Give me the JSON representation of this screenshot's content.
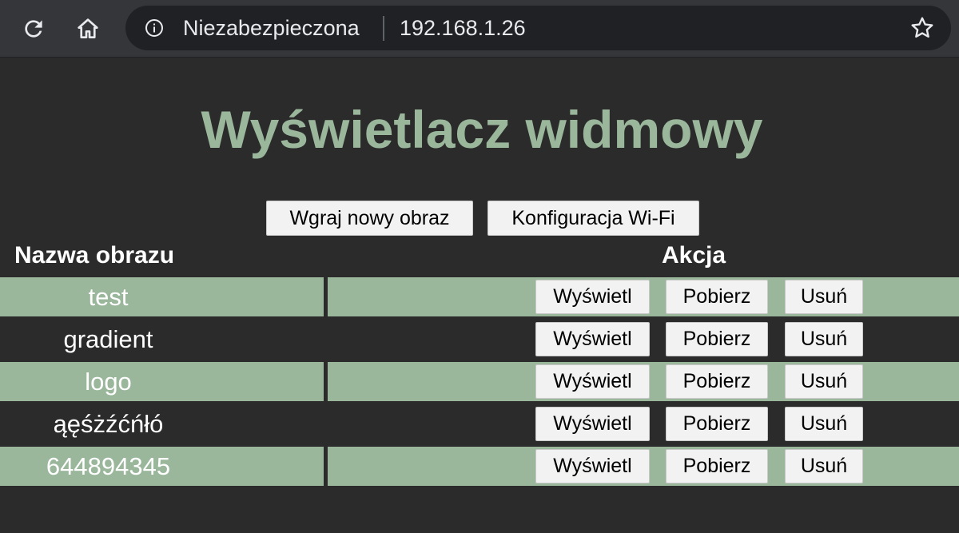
{
  "browser": {
    "security_label": "Niezabezpieczona",
    "url": "192.168.1.26",
    "icons": {
      "reload": "reload-icon",
      "home": "home-icon",
      "info": "info-icon",
      "bookmark": "star-icon"
    }
  },
  "page": {
    "title": "Wyświetlacz widmowy",
    "upload_button": "Wgraj nowy obraz",
    "wifi_button": "Konfiguracja Wi-Fi"
  },
  "table": {
    "headers": {
      "name": "Nazwa obrazu",
      "action": "Akcja"
    },
    "rows": [
      {
        "name": "test",
        "show": "Wyświetl",
        "download": "Pobierz",
        "delete": "Usuń"
      },
      {
        "name": "gradient",
        "show": "Wyświetl",
        "download": "Pobierz",
        "delete": "Usuń"
      },
      {
        "name": "logo",
        "show": "Wyświetl",
        "download": "Pobierz",
        "delete": "Usuń"
      },
      {
        "name": "ąęśżźćńłó",
        "show": "Wyświetl",
        "download": "Pobierz",
        "delete": "Usuń"
      },
      {
        "name": "644894345",
        "show": "Wyświetl",
        "download": "Pobierz",
        "delete": "Usuń"
      }
    ]
  },
  "colors": {
    "accent": "#9ab79c",
    "background": "#2b2b2b",
    "browser_chrome": "#35363a"
  }
}
